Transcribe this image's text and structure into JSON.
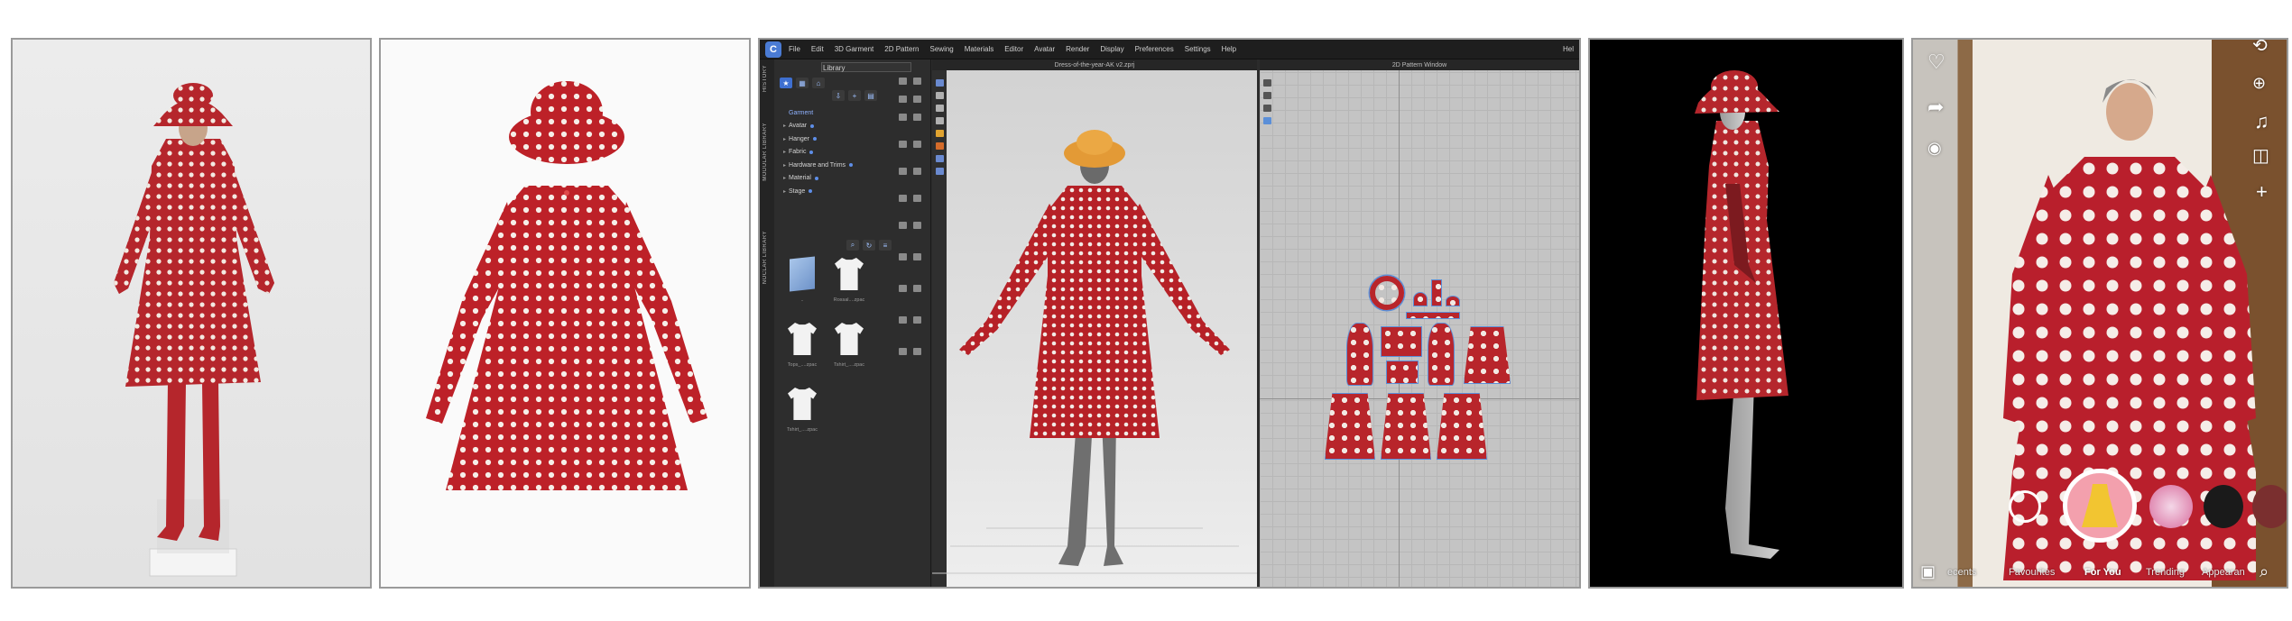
{
  "panels": {
    "photo_worn": {
      "label": "Mannequin wearing polka-dot dress"
    },
    "photo_flat": {
      "label": "Flat polka-dot dress and hat"
    }
  },
  "clo": {
    "menu": [
      "File",
      "Edit",
      "3D Garment",
      "2D Pattern",
      "Sewing",
      "Materials",
      "Editor",
      "Avatar",
      "Render",
      "Display",
      "Preferences",
      "Settings",
      "Help"
    ],
    "help_right": "Hel",
    "library_title": "Library",
    "vertical_tabs": [
      "HISTORY",
      "MODULAR LIBRARY",
      "NOCLAR LIBRARY"
    ],
    "tree": [
      "Garment",
      "Avatar",
      "Hanger",
      "Fabric",
      "Hardware and Trims",
      "Material",
      "Stage"
    ],
    "thumbs": [
      {
        "label": "..",
        "kind": "folder"
      },
      {
        "label": "Rossal....zpac",
        "kind": "shirt"
      },
      {
        "label": "Tops_....zpac",
        "kind": "shirt"
      },
      {
        "label": "Tshirt_....zpac",
        "kind": "shirt"
      },
      {
        "label": "Tshirt_....zpac",
        "kind": "shirt"
      }
    ],
    "window_3d_title": "Dress-of-the-year-AK v2.zprj",
    "window_2d_title": "2D Pattern Window",
    "accent": "#3e6fd0"
  },
  "tiktok": {
    "left_icons": [
      "heart-icon",
      "share-icon",
      "eye-icon"
    ],
    "right_icons": [
      "flip-camera-icon",
      "add-video-icon",
      "music-icon",
      "camera-icon",
      "plus-icon"
    ],
    "nav": [
      "ecents",
      "Favourites",
      "For You",
      "Trending",
      "Appearan"
    ],
    "active_nav": "For You"
  }
}
